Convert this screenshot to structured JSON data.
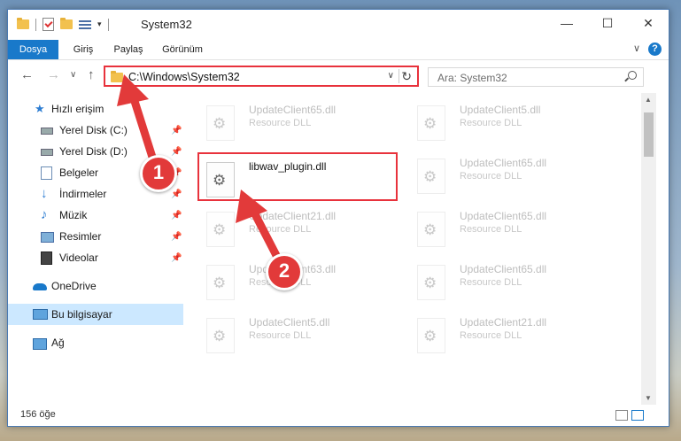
{
  "window": {
    "title": "System32",
    "controls": {
      "minimize": "—",
      "maximize": "☐",
      "close": "✕"
    }
  },
  "ribbon": {
    "tabs": [
      "Dosya",
      "Giriş",
      "Paylaş",
      "Görünüm"
    ],
    "help": "?",
    "collapse": "∨"
  },
  "nav": {
    "back": "←",
    "forward": "→",
    "recent": "∨",
    "up": "↑",
    "address": "C:\\Windows\\System32",
    "address_dropdown": "∨",
    "refresh": "↻",
    "search_placeholder": "Ara: System32"
  },
  "sidebar": {
    "items": [
      {
        "label": "Hızlı erişim",
        "icon": "star-icon"
      },
      {
        "label": "Yerel Disk (C:)",
        "icon": "drive-icon",
        "pin": "📌"
      },
      {
        "label": "Yerel Disk (D:)",
        "icon": "drive-icon",
        "pin": "📌"
      },
      {
        "label": "Belgeler",
        "icon": "documents-icon",
        "pin": "📌"
      },
      {
        "label": "İndirmeler",
        "icon": "downloads-icon",
        "pin": "📌"
      },
      {
        "label": "Müzik",
        "icon": "music-icon",
        "pin": "📌"
      },
      {
        "label": "Resimler",
        "icon": "pictures-icon",
        "pin": "📌"
      },
      {
        "label": "Videolar",
        "icon": "videos-icon",
        "pin": "📌"
      },
      {
        "label": "OneDrive",
        "icon": "cloud-icon"
      },
      {
        "label": "Bu bilgisayar",
        "icon": "computer-icon",
        "selected": true
      },
      {
        "label": "Ağ",
        "icon": "network-icon"
      }
    ]
  },
  "files": [
    {
      "name": "UpdateClient65.dll",
      "desc": "Resource DLL"
    },
    {
      "name": "UpdateClient5.dll",
      "desc": "Resource DLL"
    },
    {
      "name": "libwav_plugin.dll",
      "desc": "",
      "selected": true
    },
    {
      "name": "UpdateClient65.dll",
      "desc": "Resource DLL"
    },
    {
      "name": "UpdateClient21.dll",
      "desc": "Resource DLL"
    },
    {
      "name": "UpdateClient65.dll",
      "desc": "Resource DLL"
    },
    {
      "name": "UpdateClient63.dll",
      "desc": "Resource DLL"
    },
    {
      "name": "UpdateClient65.dll",
      "desc": "Resource DLL"
    },
    {
      "name": "UpdateClient5.dll",
      "desc": "Resource DLL"
    },
    {
      "name": "UpdateClient21.dll",
      "desc": "Resource DLL"
    }
  ],
  "status": {
    "count": "156 öğe"
  },
  "callouts": {
    "one": "1",
    "two": "2"
  },
  "colors": {
    "accent": "#1979ca",
    "highlight": "#e8323c",
    "callout": "#e23a3a",
    "selected_bg": "#cce8ff"
  }
}
